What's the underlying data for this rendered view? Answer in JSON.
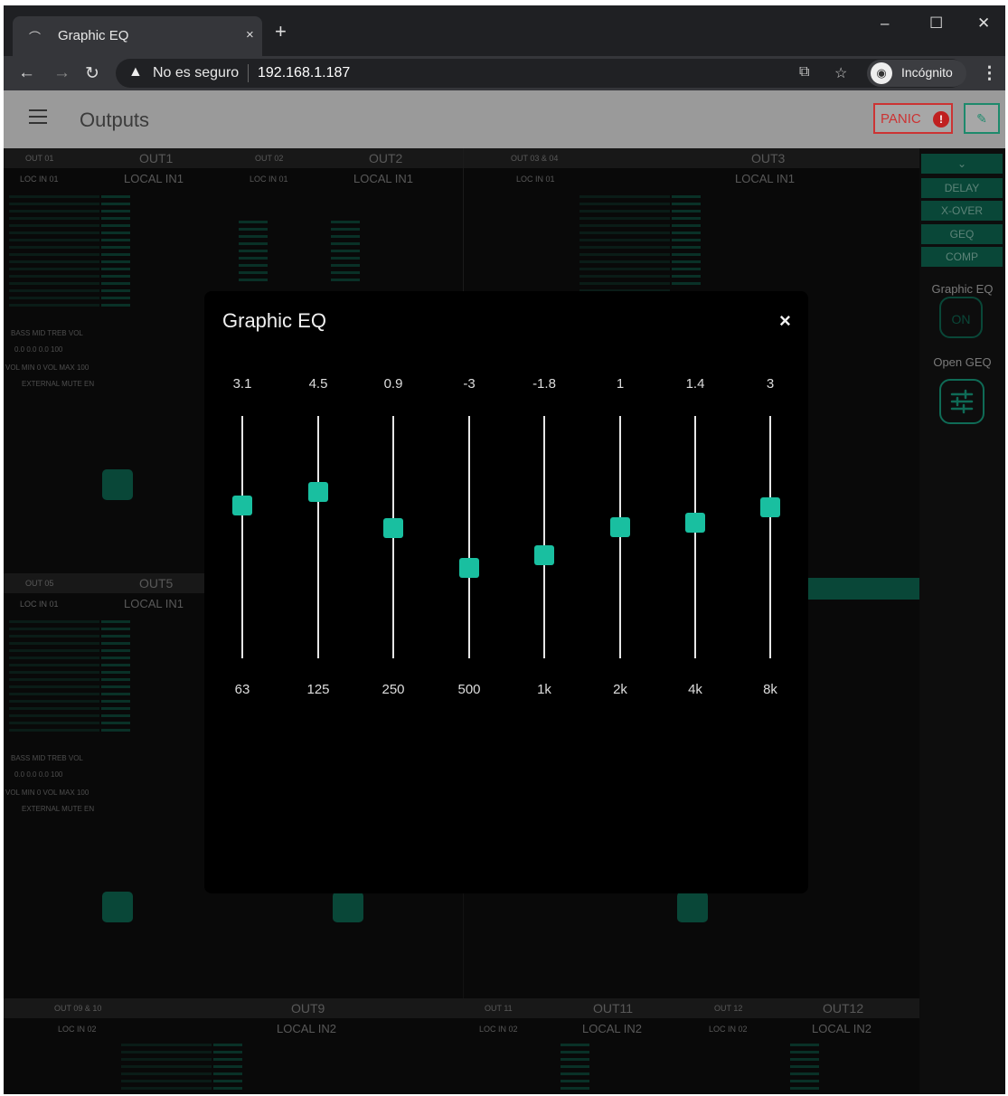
{
  "browser": {
    "tab_title": "Graphic EQ",
    "tab_close": "×",
    "new_tab": "+",
    "security_text": "No es seguro",
    "url": "192.168.1.187",
    "incognito_label": "Incógnito",
    "win_min": "–",
    "win_max": "☐",
    "win_close": "✕"
  },
  "app": {
    "page_title": "Outputs",
    "panic_label": "PANIC",
    "panic_icon": "!"
  },
  "channels": [
    {
      "small": "OUT 01",
      "name": "OUT1",
      "loc": "LOC IN 01",
      "src": "LOCAL IN1"
    },
    {
      "small": "OUT 02",
      "name": "OUT2",
      "loc": "LOC IN 01",
      "src": "LOCAL IN1"
    },
    {
      "small": "OUT 03 & 04",
      "name": "OUT3",
      "loc": "LOC IN 01",
      "src": "LOCAL IN1"
    },
    {
      "small": "OUT 05",
      "name": "OUT5",
      "loc": "LOC IN 01",
      "src": "LOCAL IN1"
    },
    {
      "small": "OUT 09 & 10",
      "name": "OUT9",
      "loc": "LOC IN 02",
      "src": "LOCAL IN2"
    },
    {
      "small": "OUT 11",
      "name": "OUT11",
      "loc": "LOC IN 02",
      "src": "LOCAL IN2"
    },
    {
      "small": "OUT 12",
      "name": "OUT12",
      "loc": "LOC IN 02",
      "src": "LOCAL IN2"
    }
  ],
  "channel_controls": {
    "tone_labels": "BASS   MID   TREB   VOL",
    "tone_values": "0.0    0.0    0.0    100",
    "vol_range": "VOL MIN    0    VOL MAX   100",
    "external_mute": "EXTERNAL MUTE EN"
  },
  "side_menu": {
    "items": [
      "DELAY",
      "X-OVER",
      "GEQ",
      "COMP"
    ],
    "geq_label": "Graphic EQ",
    "geq_state": "ON",
    "open_geq_label": "Open GEQ"
  },
  "modal": {
    "title": "Graphic EQ",
    "close": "×",
    "range_db": 12,
    "bands": [
      {
        "freq": "63",
        "gain": "3.1"
      },
      {
        "freq": "125",
        "gain": "4.5"
      },
      {
        "freq": "250",
        "gain": "0.9"
      },
      {
        "freq": "500",
        "gain": "-3"
      },
      {
        "freq": "1k",
        "gain": "-1.8"
      },
      {
        "freq": "2k",
        "gain": "1"
      },
      {
        "freq": "4k",
        "gain": "1.4"
      },
      {
        "freq": "8k",
        "gain": "3"
      }
    ]
  }
}
